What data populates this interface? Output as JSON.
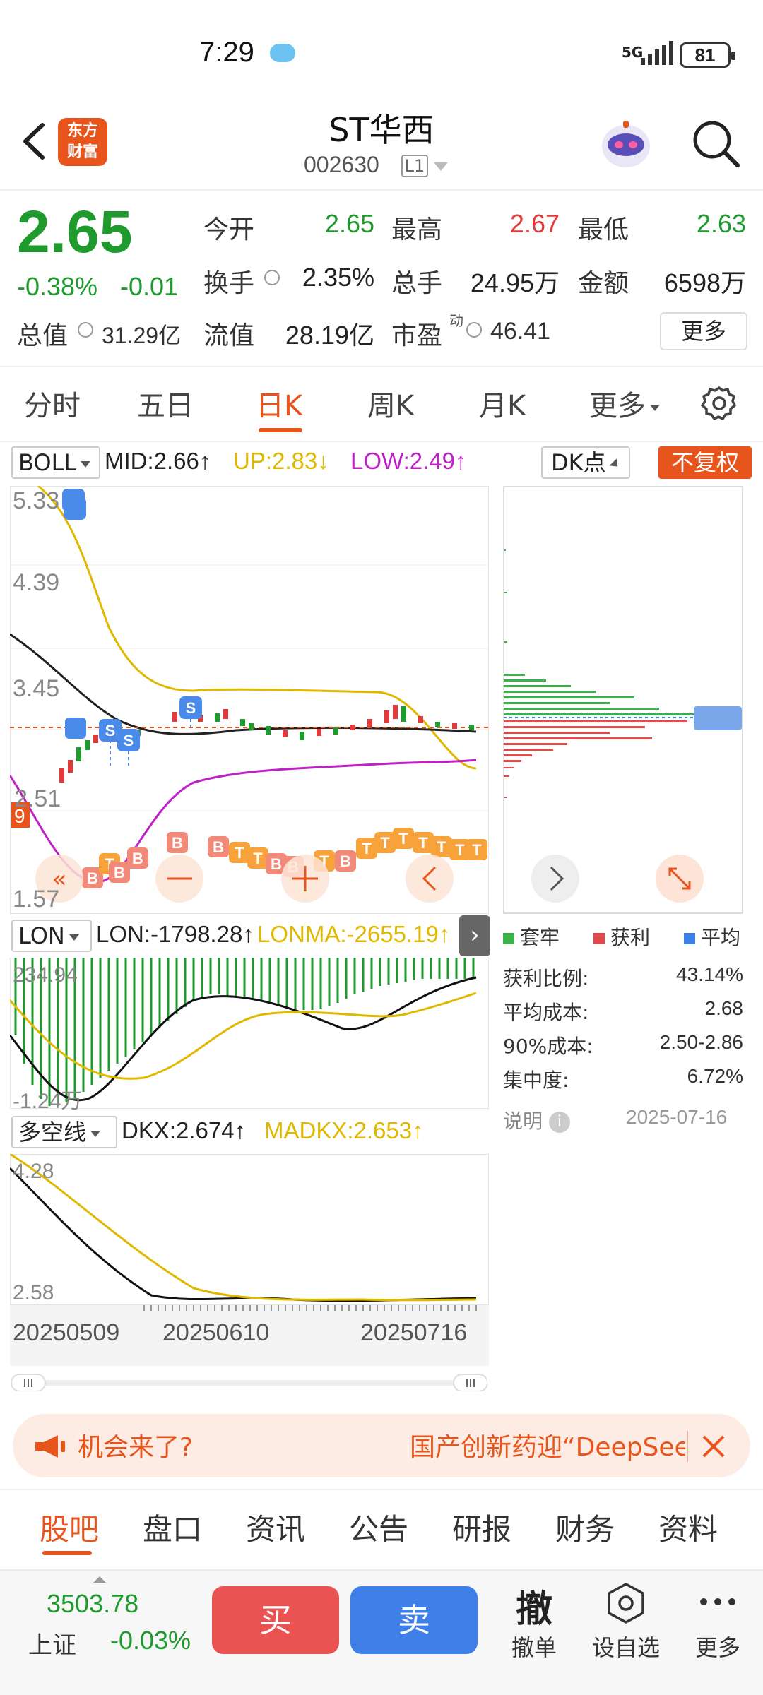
{
  "status": {
    "time": "7:29",
    "network": "5G",
    "battery": "81"
  },
  "header": {
    "logo_line1": "东方",
    "logo_line2": "财富",
    "title": "ST华西",
    "code": "002630",
    "level": "L1"
  },
  "quote": {
    "price": "2.65",
    "change_pct": "-0.38%",
    "change": "-0.01",
    "open_label": "今开",
    "open": "2.65",
    "high_label": "最高",
    "high": "2.67",
    "low_label": "最低",
    "low": "2.63",
    "turnover_label": "换手",
    "turnover": "2.35%",
    "volume_label": "总手",
    "volume": "24.95万",
    "amount_label": "金额",
    "amount": "6598万",
    "mcap_label": "总值",
    "mcap": "31.29亿",
    "float_label": "流值",
    "float": "28.19亿",
    "pe_label": "市盈",
    "pe_sup": "动",
    "pe": "46.41",
    "more": "更多"
  },
  "period_tabs": [
    "分时",
    "五日",
    "日K",
    "周K",
    "月K",
    "更多"
  ],
  "boll": {
    "selector": "BOLL",
    "mid": "MID:2.66↑",
    "up": "UP:2.83↓",
    "low": "LOW:2.49↑"
  },
  "dk_selector": "DK点",
  "adjust_button": "不复权",
  "main_axis": {
    "y_top": "5.33",
    "y_2": "4.39",
    "y_3": "3.45",
    "y_4": "2.51",
    "y_bottom": "1.57",
    "left_tag": "9"
  },
  "lon": {
    "selector": "LON",
    "lon": "LON:-1798.28↑",
    "lonma": "LONMA:-2655.19↑",
    "y_top": "234.94",
    "y_bottom": "-1.24万"
  },
  "dkx": {
    "selector": "多空线",
    "dkx": "DKX:2.674↑",
    "madkx": "MADKX:2.653↑",
    "y_top": "4.28",
    "y_bottom": "2.58"
  },
  "dates": [
    "20250509",
    "20250610",
    "20250716"
  ],
  "distribution": {
    "price_tag": "2.68",
    "legend": [
      "套牢",
      "获利",
      "平均"
    ],
    "legend_colors": [
      "#3bb24a",
      "#e24a4a",
      "#3f7fe8"
    ],
    "rows": [
      {
        "label": "获利比例:",
        "value": "43.14%"
      },
      {
        "label": "平均成本:",
        "value": "2.68"
      },
      {
        "label": "90%成本:",
        "value": "2.50-2.86"
      },
      {
        "label": "集中度:",
        "value": "6.72%"
      }
    ],
    "note": "说明",
    "date": "2025-07-16"
  },
  "banner": {
    "left": "机会来了?",
    "right": "国产创新药迎“DeepSeek时刻”"
  },
  "bottom_tabs": [
    "股吧",
    "盘口",
    "资讯",
    "公告",
    "研报",
    "财务",
    "资料"
  ],
  "index": {
    "value": "3503.78",
    "name": "上证",
    "change": "-0.03%"
  },
  "actions": {
    "buy": "买",
    "sell": "卖",
    "cancel_glyph": "撤",
    "cancel": "撤单",
    "watch": "设自选",
    "more": "更多"
  },
  "colors": {
    "up": "#e23a3a",
    "down": "#1f9b2d",
    "accent": "#e8551c",
    "mid_line": "#222222",
    "up_line": "#e0b800",
    "low_line": "#c020c8"
  }
}
